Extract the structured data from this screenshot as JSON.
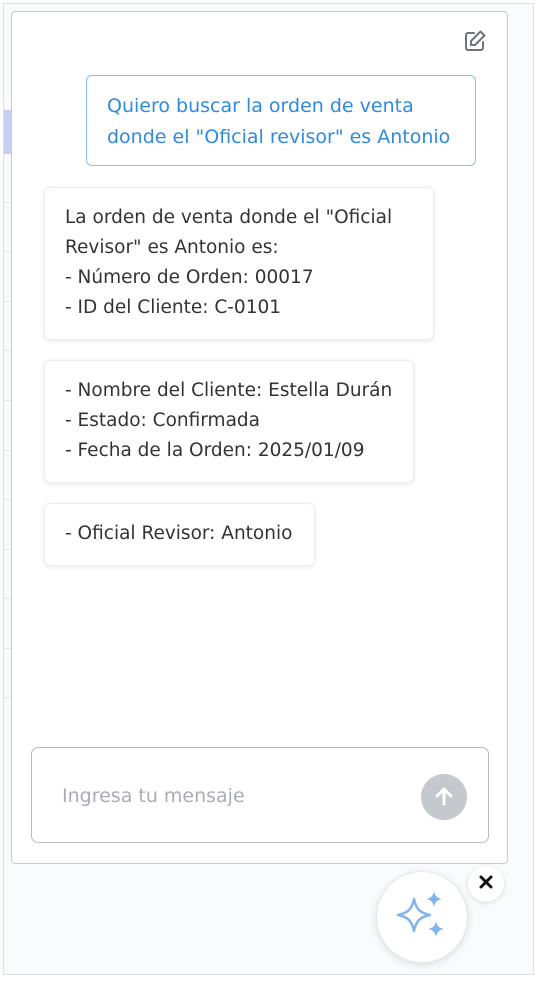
{
  "chat": {
    "new_chat_icon": "edit-icon",
    "user_message": "Quiero buscar la orden de venta\ndonde el \"Oficial revisor\" es Antonio",
    "bot_messages": [
      "La orden de venta donde el \"Oficial\nRevisor\" es Antonio es:\n- Número de Orden: 00017\n- ID del Cliente: C-0101",
      "- Nombre del Cliente: Estella Durán\n- Estado: Confirmada\n- Fecha de la Orden: 2025/01/09",
      "- Oficial Revisor: Antonio"
    ]
  },
  "composer": {
    "placeholder": "Ingresa tu mensaje",
    "value": "",
    "send_icon": "arrow-up-icon"
  },
  "assistant_launcher": {
    "icon": "sparkles-icon",
    "close_icon": "close-icon"
  },
  "colors": {
    "user_text": "#2f8ae0",
    "user_border": "#8cc0f2",
    "send_button": "#c5c8cc",
    "sparkle_blue": "#7fb4ee"
  }
}
